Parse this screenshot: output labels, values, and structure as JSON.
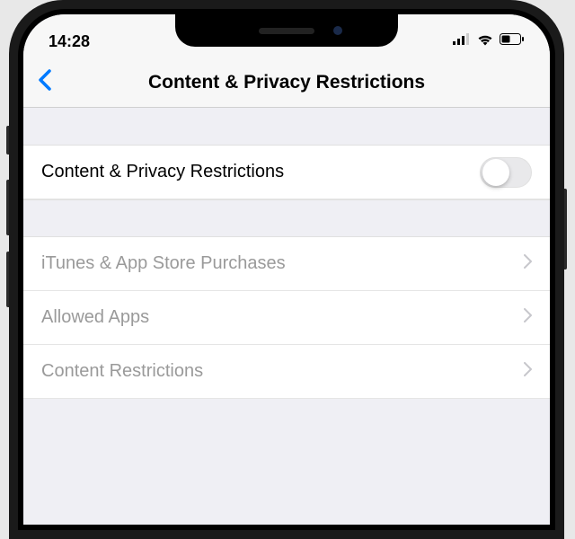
{
  "status": {
    "time": "14:28"
  },
  "nav": {
    "title": "Content & Privacy Restrictions"
  },
  "toggle_row": {
    "label": "Content & Privacy Restrictions"
  },
  "nav_items": [
    {
      "label": "iTunes & App Store Purchases"
    },
    {
      "label": "Allowed Apps"
    },
    {
      "label": "Content Restrictions"
    }
  ]
}
